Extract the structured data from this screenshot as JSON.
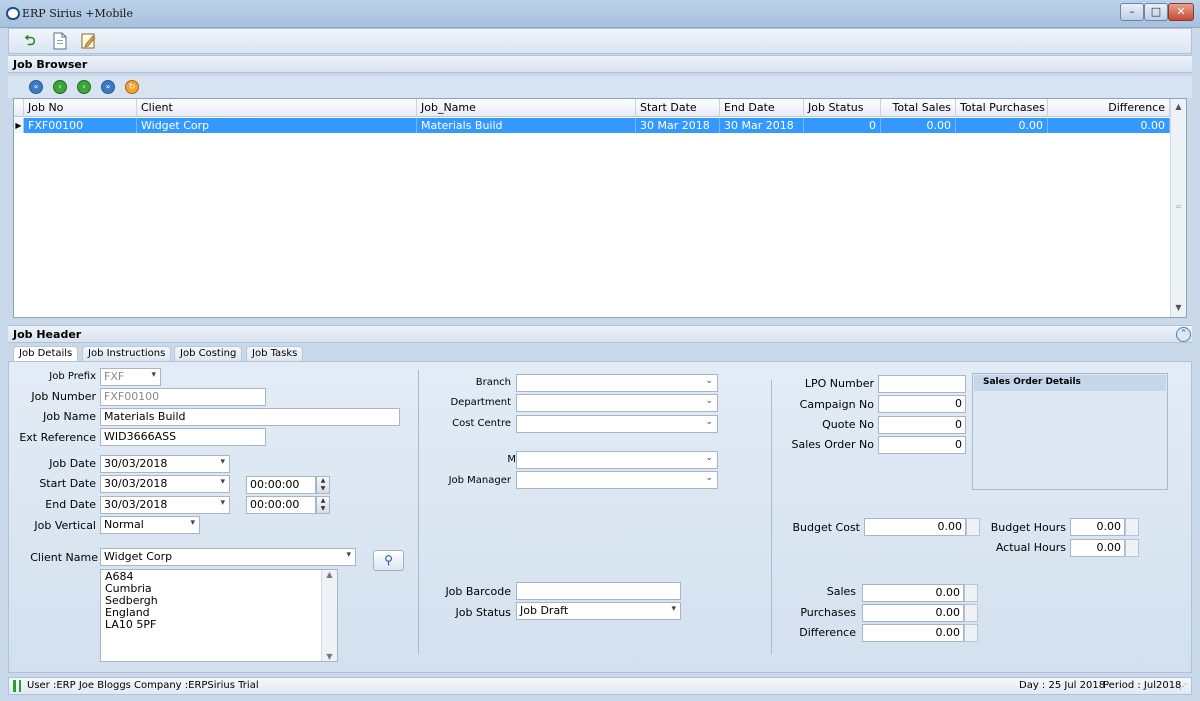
{
  "window": {
    "title": "ERP Sirius +Mobile",
    "minimize_glyph": "–",
    "maximize_glyph": "□",
    "close_glyph": "✕"
  },
  "toolbar": {
    "icons": [
      "refresh-icon",
      "new-document-icon",
      "edit-document-icon"
    ]
  },
  "job_browser": {
    "title": "Job Browser",
    "nav_icons": [
      "first-record-icon",
      "previous-record-icon",
      "next-record-icon",
      "last-record-icon",
      "refresh-records-icon"
    ],
    "columns": [
      "Job  No",
      "Client",
      "Job_Name",
      "Start Date",
      "End Date",
      "Job Status",
      "Total Sales",
      "Total Purchases",
      "Difference"
    ],
    "rows": [
      {
        "job_no": "FXF00100",
        "client": "Widget Corp",
        "job_name": "Materials Build",
        "start_date": "30 Mar 2018",
        "end_date": "30 Mar 2018",
        "job_status": "0",
        "total_sales": "0.00",
        "total_purchases": "0.00",
        "difference": "0.00"
      }
    ]
  },
  "job_header": {
    "title": "Job Header",
    "tabs": [
      "Job Details",
      "Job Instructions",
      "Job Costing",
      "Job Tasks"
    ],
    "active_tab": "Job Details"
  },
  "details": {
    "job_prefix": {
      "label": "Job Prefix",
      "value": "FXF"
    },
    "job_number": {
      "label": "Job Number",
      "value": "FXF00100"
    },
    "job_name": {
      "label": "Job Name",
      "value": "Materials Build"
    },
    "ext_reference": {
      "label": "Ext Reference",
      "value": "WID3666ASS"
    },
    "job_date": {
      "label": "Job Date",
      "value": "30/03/2018"
    },
    "start_date": {
      "label": "Start Date",
      "value": "30/03/2018",
      "time": "00:00:00"
    },
    "end_date": {
      "label": "End Date",
      "value": "30/03/2018",
      "time": "00:00:00"
    },
    "job_vertical": {
      "label": "Job Vertical",
      "value": "Normal"
    },
    "client_name": {
      "label": "Client Name",
      "value": "Widget Corp"
    },
    "address": [
      "A684",
      "Cumbria",
      "Sedbergh",
      "England",
      "LA10 5PF"
    ]
  },
  "middle": {
    "branch": {
      "label": "Branch",
      "value": ""
    },
    "department": {
      "label": "Department",
      "value": ""
    },
    "cost_centre": {
      "label": "Cost Centre",
      "value": ""
    },
    "unnamed": {
      "label": "M",
      "value": ""
    },
    "job_manager": {
      "label": "Job Manager",
      "value": ""
    },
    "job_barcode": {
      "label": "Job Barcode",
      "value": ""
    },
    "job_status": {
      "label": "Job Status",
      "value": "Job Draft"
    }
  },
  "right": {
    "lpo_number": {
      "label": "LPO Number",
      "value": ""
    },
    "campaign_no": {
      "label": "Campaign No",
      "value": "0"
    },
    "quote_no": {
      "label": "Quote No",
      "value": "0"
    },
    "sales_order_no": {
      "label": "Sales Order No",
      "value": "0"
    },
    "sales_order_details": {
      "title": "Sales Order Details"
    },
    "budget_cost": {
      "label": "Budget Cost",
      "value": "0.00"
    },
    "budget_hours": {
      "label": "Budget Hours",
      "value": "0.00"
    },
    "actual_hours": {
      "label": "Actual Hours",
      "value": "0.00"
    },
    "sales": {
      "label": "Sales",
      "value": "0.00"
    },
    "purchases": {
      "label": "Purchases",
      "value": "0.00"
    },
    "difference": {
      "label": "Difference",
      "value": "0.00"
    }
  },
  "status_bar": {
    "user": "User :ERP Joe Bloggs",
    "company": "Company :ERPSirius Trial",
    "day": "Day : 25 Jul 2018",
    "period": "Period : Jul2018"
  }
}
